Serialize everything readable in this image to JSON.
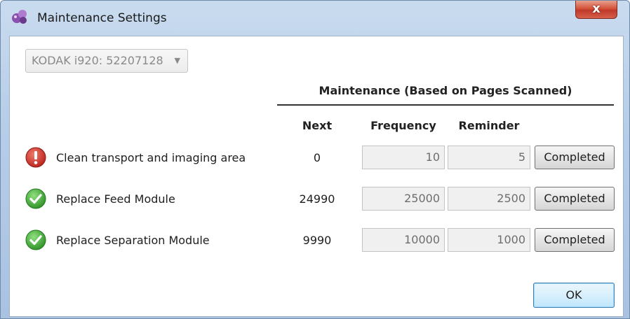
{
  "window": {
    "title": "Maintenance Settings",
    "close_label": "x"
  },
  "device_select": {
    "value": "KODAK i920: 52207128"
  },
  "maintenance": {
    "group_header": "Maintenance (Based on Pages Scanned)",
    "columns": {
      "next": "Next",
      "frequency": "Frequency",
      "reminder": "Reminder"
    },
    "rows": [
      {
        "status": "error",
        "status_icon": "error-icon",
        "task": "Clean transport and imaging area",
        "next": "0",
        "frequency": "10",
        "reminder": "5",
        "button": "Completed"
      },
      {
        "status": "ok",
        "status_icon": "check-icon",
        "task": "Replace Feed Module",
        "next": "24990",
        "frequency": "25000",
        "reminder": "2500",
        "button": "Completed"
      },
      {
        "status": "ok",
        "status_icon": "check-icon",
        "task": "Replace Separation Module",
        "next": "9990",
        "frequency": "10000",
        "reminder": "1000",
        "button": "Completed"
      }
    ]
  },
  "footer": {
    "ok_label": "OK"
  },
  "colors": {
    "error": "#d9332b",
    "ok": "#3aa532",
    "ok_button_border": "#3c7fb1"
  }
}
